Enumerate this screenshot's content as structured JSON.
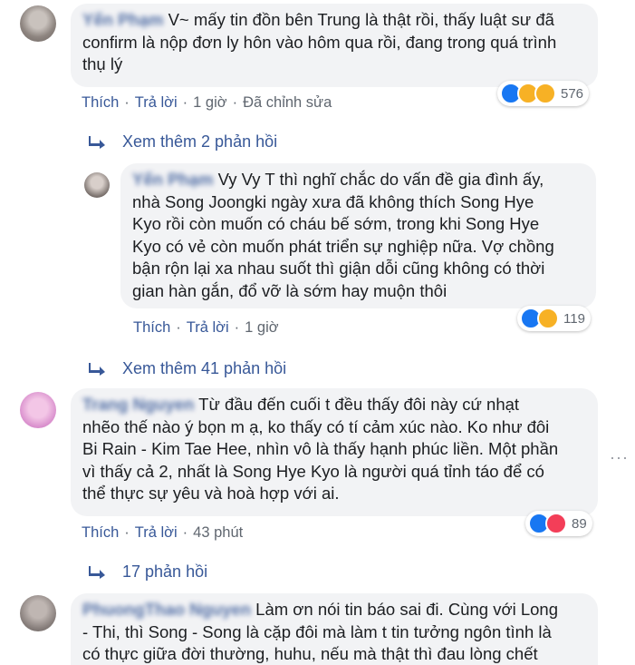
{
  "comments": [
    {
      "author": "Yến Phạm",
      "text_line1": "V~ mấy tin đồn bên Trung là thật rồi, thấy luật sư đã",
      "text_line2": "confirm là nộp đơn ly hôn vào hôm qua rồi, đang trong quá trình",
      "text_line3": "thụ lý",
      "like_label": "Thích",
      "reply_label": "Trả lời",
      "time": "1 giờ",
      "edited": "Đã chỉnh sửa",
      "reaction_count": "576",
      "reaction_icons": [
        "like-icon",
        "sad-icon",
        "wow-icon"
      ]
    },
    {
      "author": "Yến Phạm",
      "text_line1": "Vy Vy T thì nghĩ chắc do vấn đề gia đình ấy,",
      "text_line2": "nhà Song Joongki ngày xưa đã không thích Song Hye",
      "text_line3": "Kyo rồi còn muốn có cháu bế sớm, trong khi Song Hye",
      "text_line4": "Kyo có vẻ còn muốn phát triển sự nghiệp nữa. Vợ chồng",
      "text_line5": "bận rộn lại xa nhau suốt thì giận dỗi cũng không có thời",
      "text_line6": "gian hàn gắn, đổ vỡ là sớm hay muộn thôi",
      "like_label": "Thích",
      "reply_label": "Trả lời",
      "time": "1 giờ",
      "reaction_count": "119",
      "reaction_icons": [
        "like-icon",
        "sad-icon"
      ]
    },
    {
      "author": "Trang Nguyen",
      "text_line1": "Từ đầu đến cuối t đều thấy đôi này cứ nhạt",
      "text_line2": "nhẽo thế nào ý bọn m ạ, ko thấy có tí cảm xúc nào. Ko như đôi",
      "text_line3": "Bi Rain - Kim Tae Hee, nhìn vô là thấy hạnh phúc liền. Một phần",
      "text_line4": "vì thấy cả 2, nhất là Song Hye Kyo là người quá tỉnh táo để có",
      "text_line5": "thể thực sự yêu và hoà hợp với ai.",
      "like_label": "Thích",
      "reply_label": "Trả lời",
      "time": "43 phút",
      "reaction_count": "89",
      "reaction_icons": [
        "like-icon",
        "love-icon"
      ]
    },
    {
      "author": "PhuongThao Nguyen",
      "text_line1": "Làm ơn nói tin báo sai đi. Cùng với Long",
      "text_line2": "- Thi, thì Song - Song là cặp đôi mà làm t tin tưởng ngôn tình là",
      "text_line3": "có thực giữa đời thường, huhu, nếu mà thật thì đau lòng chết"
    }
  ],
  "more_replies": [
    {
      "label": "Xem thêm 2 phản hồi"
    },
    {
      "label": "Xem thêm 41 phản hồi"
    },
    {
      "label": "17 phản hồi"
    }
  ],
  "options_glyph": "···",
  "colors": {
    "link": "#385898",
    "bubble": "#f2f3f5",
    "meta": "#606770"
  }
}
